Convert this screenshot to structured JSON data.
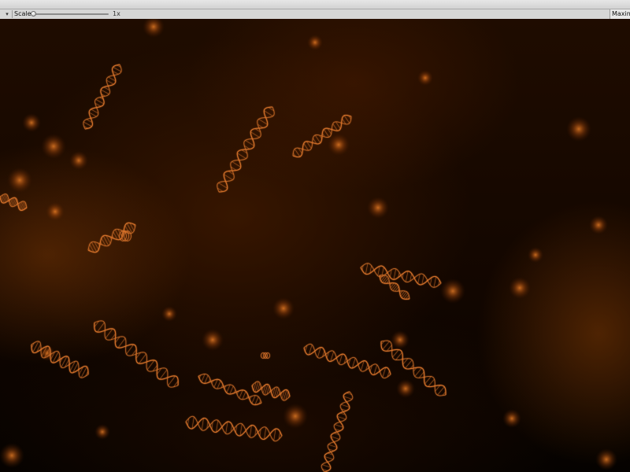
{
  "toolbar": {
    "dropdown_glyph": "▾",
    "scale_label": "Scale",
    "scale_value": "1x",
    "scale_fraction": 0.0,
    "maximize_label": "Maxim"
  },
  "viewport": {
    "background_color": "#140700",
    "accent_color": "#d9732a",
    "glow_color": "#e07020"
  }
}
